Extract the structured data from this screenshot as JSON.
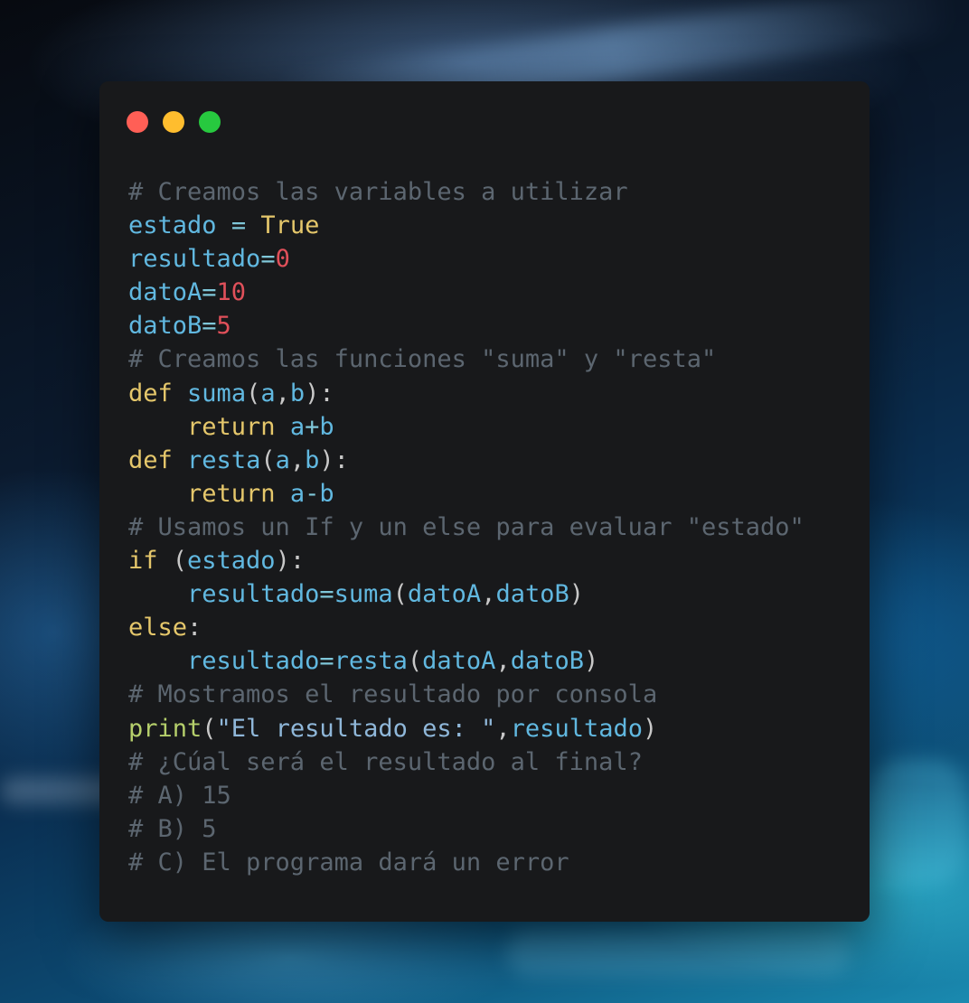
{
  "window": {
    "controls": [
      "close",
      "minimize",
      "maximize"
    ],
    "colors": {
      "close": "#ff5f56",
      "minimize": "#ffbd2e",
      "maximize": "#27c93f",
      "background": "#18191b"
    }
  },
  "code": {
    "language": "python",
    "lines": [
      [
        {
          "t": "com",
          "v": "# Creamos las variables a utilizar"
        }
      ],
      [
        {
          "t": "var",
          "v": "estado"
        },
        {
          "t": "pun",
          "v": " "
        },
        {
          "t": "op",
          "v": "="
        },
        {
          "t": "pun",
          "v": " "
        },
        {
          "t": "kw",
          "v": "True"
        }
      ],
      [
        {
          "t": "var",
          "v": "resultado"
        },
        {
          "t": "op",
          "v": "="
        },
        {
          "t": "num",
          "v": "0"
        }
      ],
      [
        {
          "t": "var",
          "v": "datoA"
        },
        {
          "t": "op",
          "v": "="
        },
        {
          "t": "num",
          "v": "10"
        }
      ],
      [
        {
          "t": "var",
          "v": "datoB"
        },
        {
          "t": "op",
          "v": "="
        },
        {
          "t": "num",
          "v": "5"
        }
      ],
      [
        {
          "t": "com",
          "v": "# Creamos las funciones \"suma\" y \"resta\""
        }
      ],
      [
        {
          "t": "kw",
          "v": "def"
        },
        {
          "t": "pun",
          "v": " "
        },
        {
          "t": "var",
          "v": "suma"
        },
        {
          "t": "pun",
          "v": "("
        },
        {
          "t": "var",
          "v": "a"
        },
        {
          "t": "pun",
          "v": ","
        },
        {
          "t": "var",
          "v": "b"
        },
        {
          "t": "pun",
          "v": "):"
        }
      ],
      [
        {
          "t": "pun",
          "v": "    "
        },
        {
          "t": "kw",
          "v": "return"
        },
        {
          "t": "pun",
          "v": " "
        },
        {
          "t": "var",
          "v": "a"
        },
        {
          "t": "op",
          "v": "+"
        },
        {
          "t": "var",
          "v": "b"
        }
      ],
      [
        {
          "t": "kw",
          "v": "def"
        },
        {
          "t": "pun",
          "v": " "
        },
        {
          "t": "var",
          "v": "resta"
        },
        {
          "t": "pun",
          "v": "("
        },
        {
          "t": "var",
          "v": "a"
        },
        {
          "t": "pun",
          "v": ","
        },
        {
          "t": "var",
          "v": "b"
        },
        {
          "t": "pun",
          "v": "):"
        }
      ],
      [
        {
          "t": "pun",
          "v": "    "
        },
        {
          "t": "kw",
          "v": "return"
        },
        {
          "t": "pun",
          "v": " "
        },
        {
          "t": "var",
          "v": "a"
        },
        {
          "t": "op",
          "v": "-"
        },
        {
          "t": "var",
          "v": "b"
        }
      ],
      [
        {
          "t": "com",
          "v": "# Usamos un If y un else para evaluar \"estado\""
        }
      ],
      [
        {
          "t": "kw",
          "v": "if"
        },
        {
          "t": "pun",
          "v": " ("
        },
        {
          "t": "var",
          "v": "estado"
        },
        {
          "t": "pun",
          "v": "):"
        }
      ],
      [
        {
          "t": "pun",
          "v": "    "
        },
        {
          "t": "var",
          "v": "resultado"
        },
        {
          "t": "op",
          "v": "="
        },
        {
          "t": "var",
          "v": "suma"
        },
        {
          "t": "pun",
          "v": "("
        },
        {
          "t": "var",
          "v": "datoA"
        },
        {
          "t": "pun",
          "v": ","
        },
        {
          "t": "var",
          "v": "datoB"
        },
        {
          "t": "pun",
          "v": ")"
        }
      ],
      [
        {
          "t": "kw",
          "v": "else"
        },
        {
          "t": "pun",
          "v": ":"
        }
      ],
      [
        {
          "t": "pun",
          "v": "    "
        },
        {
          "t": "var",
          "v": "resultado"
        },
        {
          "t": "op",
          "v": "="
        },
        {
          "t": "var",
          "v": "resta"
        },
        {
          "t": "pun",
          "v": "("
        },
        {
          "t": "var",
          "v": "datoA"
        },
        {
          "t": "pun",
          "v": ","
        },
        {
          "t": "var",
          "v": "datoB"
        },
        {
          "t": "pun",
          "v": ")"
        }
      ],
      [
        {
          "t": "com",
          "v": "# Mostramos el resultado por consola"
        }
      ],
      [
        {
          "t": "fn",
          "v": "print"
        },
        {
          "t": "pun",
          "v": "("
        },
        {
          "t": "str",
          "v": "\"El resultado es: \""
        },
        {
          "t": "pun",
          "v": ","
        },
        {
          "t": "var",
          "v": "resultado"
        },
        {
          "t": "pun",
          "v": ")"
        }
      ],
      [
        {
          "t": "com",
          "v": "# ¿Cúal será el resultado al final?"
        }
      ],
      [
        {
          "t": "com",
          "v": "# A) 15"
        }
      ],
      [
        {
          "t": "com",
          "v": "# B) 5"
        }
      ],
      [
        {
          "t": "com",
          "v": "# C) El programa dará un error"
        }
      ]
    ]
  }
}
